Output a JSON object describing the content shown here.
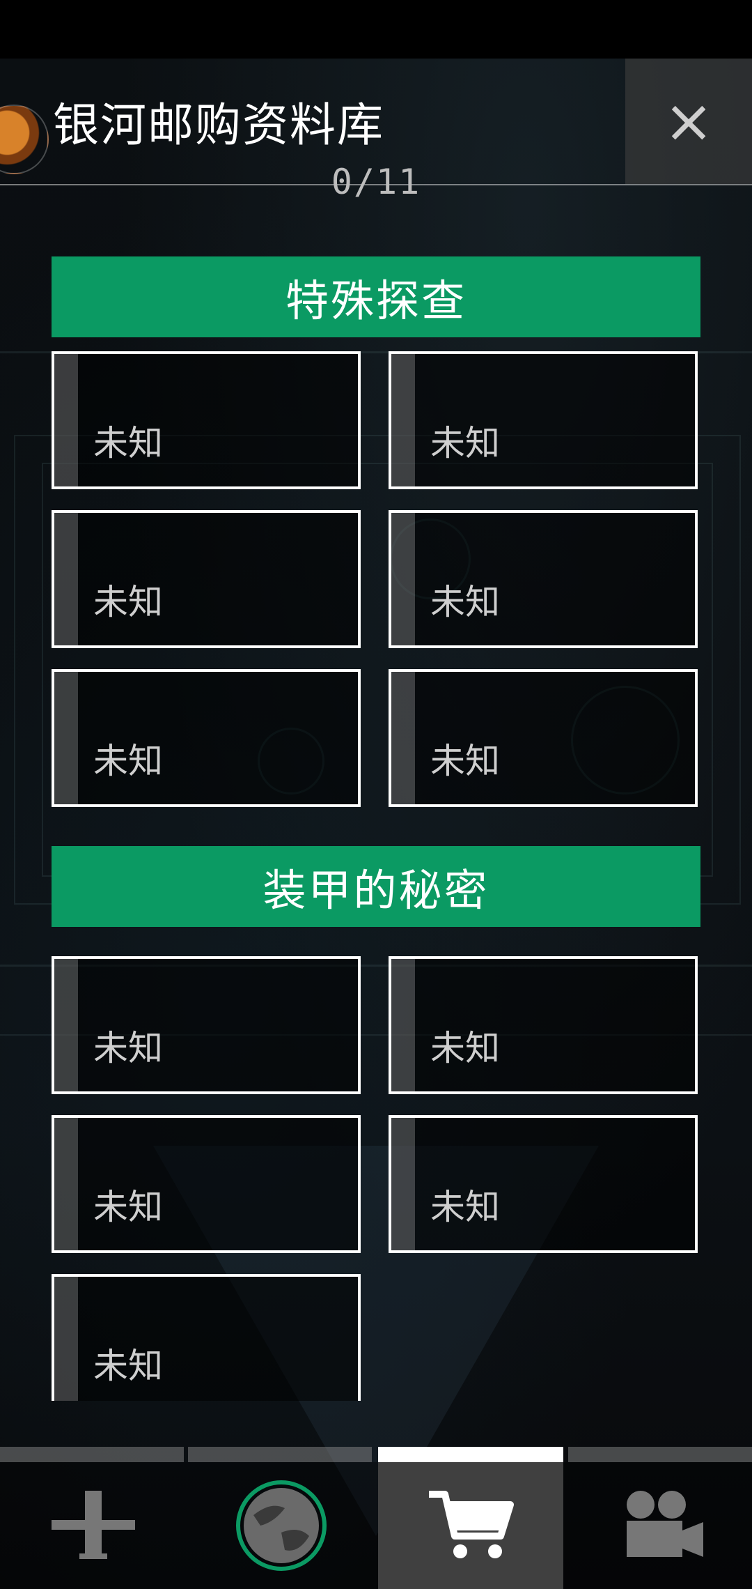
{
  "header": {
    "title": "银河邮购资料库",
    "progress": "0/11",
    "close_label": "×"
  },
  "sections": [
    {
      "title": "特殊探查",
      "items": [
        "未知",
        "未知",
        "未知",
        "未知",
        "未知",
        "未知"
      ]
    },
    {
      "title": "装甲的秘密",
      "items": [
        "未知",
        "未知",
        "未知",
        "未知",
        "未知"
      ]
    }
  ],
  "nav": {
    "items": [
      {
        "icon": "tower-icon"
      },
      {
        "icon": "planet-icon"
      },
      {
        "icon": "cart-icon",
        "active": true
      },
      {
        "icon": "camera-icon"
      }
    ]
  },
  "colors": {
    "section_header": "#0b9a63",
    "active_tab": "#404040"
  }
}
